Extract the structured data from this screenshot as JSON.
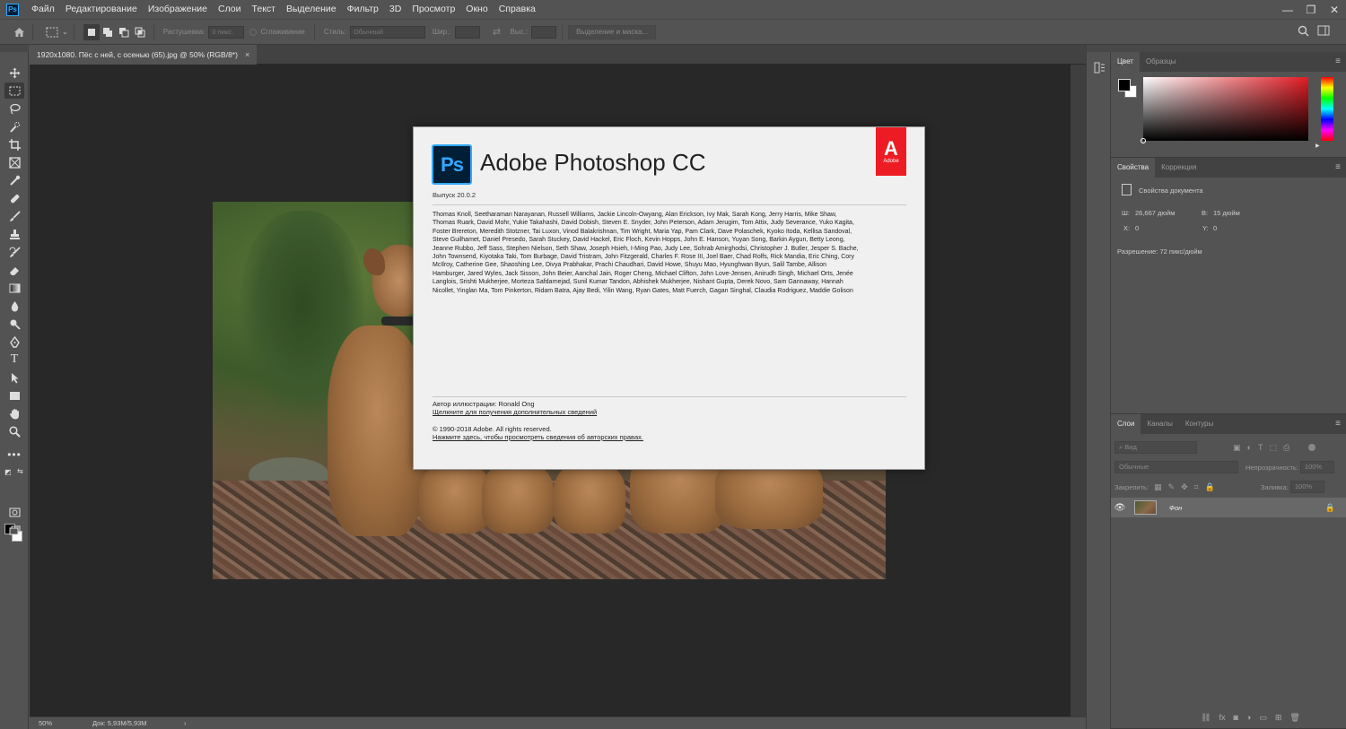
{
  "app": {
    "logo_text": "Ps"
  },
  "menubar": {
    "items": [
      "Файл",
      "Редактирование",
      "Изображение",
      "Слои",
      "Текст",
      "Выделение",
      "Фильтр",
      "3D",
      "Просмотр",
      "Окно",
      "Справка"
    ]
  },
  "window_controls": {
    "minimize": "—",
    "restore": "❐",
    "close": "✕"
  },
  "options_bar": {
    "feather_label": "Растушевка:",
    "feather_value": "0 пикс.",
    "antialias_label": "Сглаживание",
    "style_label": "Стиль:",
    "style_value": "Обычный",
    "width_label": "Шир.:",
    "height_label": "Выс.:",
    "select_mask_label": "Выделение и маска..."
  },
  "document": {
    "tab_title": "1920x1080. Пёс с ней, с осенью (65).jpg @ 50% (RGB/8*)",
    "tab_close": "×"
  },
  "about_dialog": {
    "logo_text": "Ps",
    "title": "Adobe Photoshop CC",
    "adobe_logo_text": "A",
    "adobe_word": "Adobe",
    "version": "Выпуск 20.0.2",
    "credits": "Thomas Knoll, Seetharaman Narayanan, Russell Williams, Jackie Lincoln-Owyang, Alan Erickson, Ivy Mak, Sarah Kong, Jerry Harris, Mike Shaw, Thomas Ruark, David Mohr, Yukie Takahashi, David Dobish, Steven E. Snyder, John Peterson, Adam Jerugim, Tom Attix, Judy Severance, Yuko Kagita, Foster Brereton, Meredith Stotzner, Tai Luxon, Vinod Balakrishnan, Tim Wright, Maria Yap, Pam Clark, Dave Polaschek, Kyoko Itoda, Kellisa Sandoval, Steve Guilhamet, Daniel Presedo, Sarah Stuckey, David Hackel, Eric Floch, Kevin Hopps, John E. Hanson, Yuyan Song, Barkin Aygun, Betty Leong, Jeanne Rubbo, Jeff Sass, Stephen Nielson, Seth Shaw, Joseph Hsieh, I-Ming Pao, Judy Lee, Sohrab Amirghodsi, Christopher J. Butler, Jesper S. Bache, John Townsend, Kiyotaka Taki, Tom Burbage, David Tristram, John Fitzgerald, Charles F. Rose III, Joel Baer, Chad Rolfs, Rick Mandia, Eric Ching, Cory McIlroy, Catherine Gee, Shaoshing Lee, Divya Prabhakar, Prachi Chaudhari, David Howe, Shuyu Mao, Hyunghwan Byun, Salil Tambe, Allison Hamburger, Jared Wyles, Jack Sisson, John Beier, Aanchal Jain, Roger Cheng, Michael Clifton, John Love-Jensen, Anirudh Singh, Michael Orts, Jenée Langlois, Srishti Mukherjee, Morteza Safdarnejad, Sunil Kumar Tandon, Abhishek Mukherjee, Nishant Gupta, Derek Novo, Sam Gannaway, Hannah Nicollet, Yinglan Ma, Tom Pinkerton, Ridam Batra, Ajay Bedi, Yilin Wang, Ryan Gates, Matt Fuerch, Gagan Singhal, Claudia Rodriguez, Maddie Golison",
    "illustration_credit": "Автор иллюстрации: Ronald Ong",
    "illustration_link": "Щелкните для получения дополнительных сведений",
    "copyright": "© 1990-2018 Adobe. All rights reserved.",
    "legal_link": "Нажмите здесь, чтобы просмотреть сведения об авторских правах."
  },
  "status_bar": {
    "zoom": "50%",
    "doc_size": "Док: 5,93M/5,93M",
    "arrow": "›"
  },
  "panels": {
    "color": {
      "tabs": [
        "Цвет",
        "Образцы"
      ],
      "fg_color": "#000000",
      "bg_color": "#ffffff",
      "hue_color": "#e21c24"
    },
    "properties": {
      "tabs": [
        "Свойства",
        "Коррекция"
      ],
      "doc_props_label": "Свойства документа",
      "w_label": "Ш:",
      "w_value": "26,667 дюйм",
      "h_label": "В:",
      "h_value": "15 дюйм",
      "x_label": "X:",
      "x_value": "0",
      "y_label": "Y:",
      "y_value": "0",
      "resolution": "Разрешение: 72 пикс/дюйм"
    },
    "layers": {
      "tabs": [
        "Слои",
        "Каналы",
        "Контуры"
      ],
      "search_placeholder": "Вид",
      "blend_mode": "Обычные",
      "opacity_label": "Непрозрачность:",
      "opacity_value": "100%",
      "lock_label": "Закрепить:",
      "fill_label": "Заливка:",
      "fill_value": "100%",
      "layer_name": "Фон"
    }
  }
}
